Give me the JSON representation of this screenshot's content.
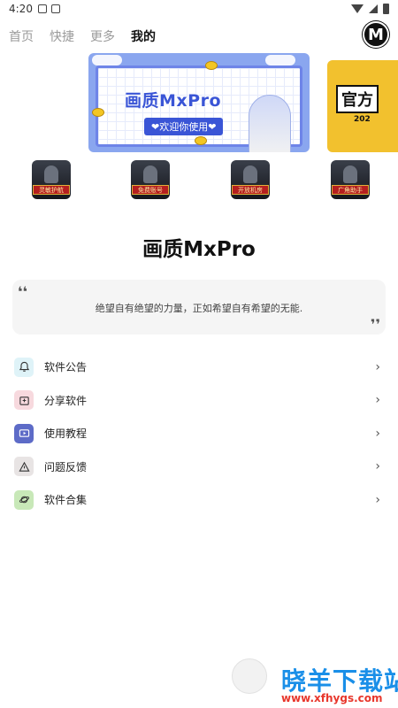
{
  "status_bar": {
    "time": "4:20"
  },
  "top_nav": {
    "tabs": [
      {
        "label": "首页",
        "active": false
      },
      {
        "label": "快捷",
        "active": false
      },
      {
        "label": "更多",
        "active": false
      },
      {
        "label": "我的",
        "active": true
      }
    ],
    "logo_letter": "M"
  },
  "banner": {
    "main_title": "画质MxPro",
    "main_subtitle": "❤欢迎你使用❤",
    "side_title": "官方",
    "side_year": "202"
  },
  "shortcuts": [
    {
      "tag": "灵敏护航"
    },
    {
      "tag": "免费账号"
    },
    {
      "tag": "开放机房"
    },
    {
      "tag": "广角助手"
    }
  ],
  "app_title": "画质MxPro",
  "quote": {
    "open_mark": "❛❛",
    "text": "绝望自有绝望的力量，正如希望自有希望的无能.",
    "close_mark": "❜❜"
  },
  "menu": {
    "items": [
      {
        "label": "软件公告",
        "icon": "bell-icon",
        "color": "#dff3f8"
      },
      {
        "label": "分享软件",
        "icon": "share-icon",
        "color": "#f7d9de"
      },
      {
        "label": "使用教程",
        "icon": "video-icon",
        "color": "#5d6bc7"
      },
      {
        "label": "问题反馈",
        "icon": "warning-icon",
        "color": "#e8e4e4"
      },
      {
        "label": "软件合集",
        "icon": "planet-icon",
        "color": "#c8e8b8"
      }
    ],
    "chevron": "›"
  },
  "watermark": {
    "name": "晓羊下载站",
    "url": "www.xfhygs.com"
  }
}
